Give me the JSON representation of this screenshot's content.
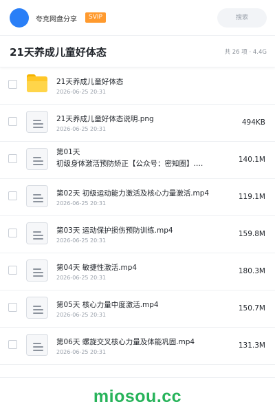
{
  "header": {
    "username": "夸克网盘分享",
    "badge": "SVIP",
    "search_placeholder": "搜索"
  },
  "folder": {
    "title": "21天养成儿童好体态",
    "meta": "共 26 项 · 4.4G"
  },
  "files": [
    {
      "name": "21天养成儿童好体态",
      "date": "2026-06-25 20:31",
      "size": "",
      "type": "folder"
    },
    {
      "name": "21天养成儿童好体态说明.png",
      "date": "2026-06-25 20:31",
      "size": "494KB",
      "type": "file"
    },
    {
      "name": "第01天",
      "name_line2": "初级身体激活预防矫正【公众号：密知圈】.…",
      "date": "2026-06-25 20:31",
      "size": "140.1M",
      "type": "file"
    },
    {
      "name": "第02天 初级运动能力激活及核心力量激活.mp4",
      "date": "2026-06-25 20:31",
      "size": "119.1M",
      "type": "file"
    },
    {
      "name": "第03天 运动保护损伤预防训练.mp4",
      "date": "2026-06-25 20:31",
      "size": "159.8M",
      "type": "file"
    },
    {
      "name": "第04天 敏捷性激活.mp4",
      "date": "2026-06-25 20:31",
      "size": "180.3M",
      "type": "file"
    },
    {
      "name": "第05天 核心力量中度激活.mp4",
      "date": "2026-06-25 20:31",
      "size": "150.7M",
      "type": "file"
    },
    {
      "name": "第06天 螺旋交叉核心力量及体能巩固.mp4",
      "date": "2026-06-25 20:31",
      "size": "131.3M",
      "type": "file"
    }
  ],
  "watermark": "miosou.cc",
  "colors": {
    "avatar": "#2a7ff7",
    "svip": "#ff9a2e",
    "folder": "#ffc727",
    "watermark": "#27b35a"
  }
}
